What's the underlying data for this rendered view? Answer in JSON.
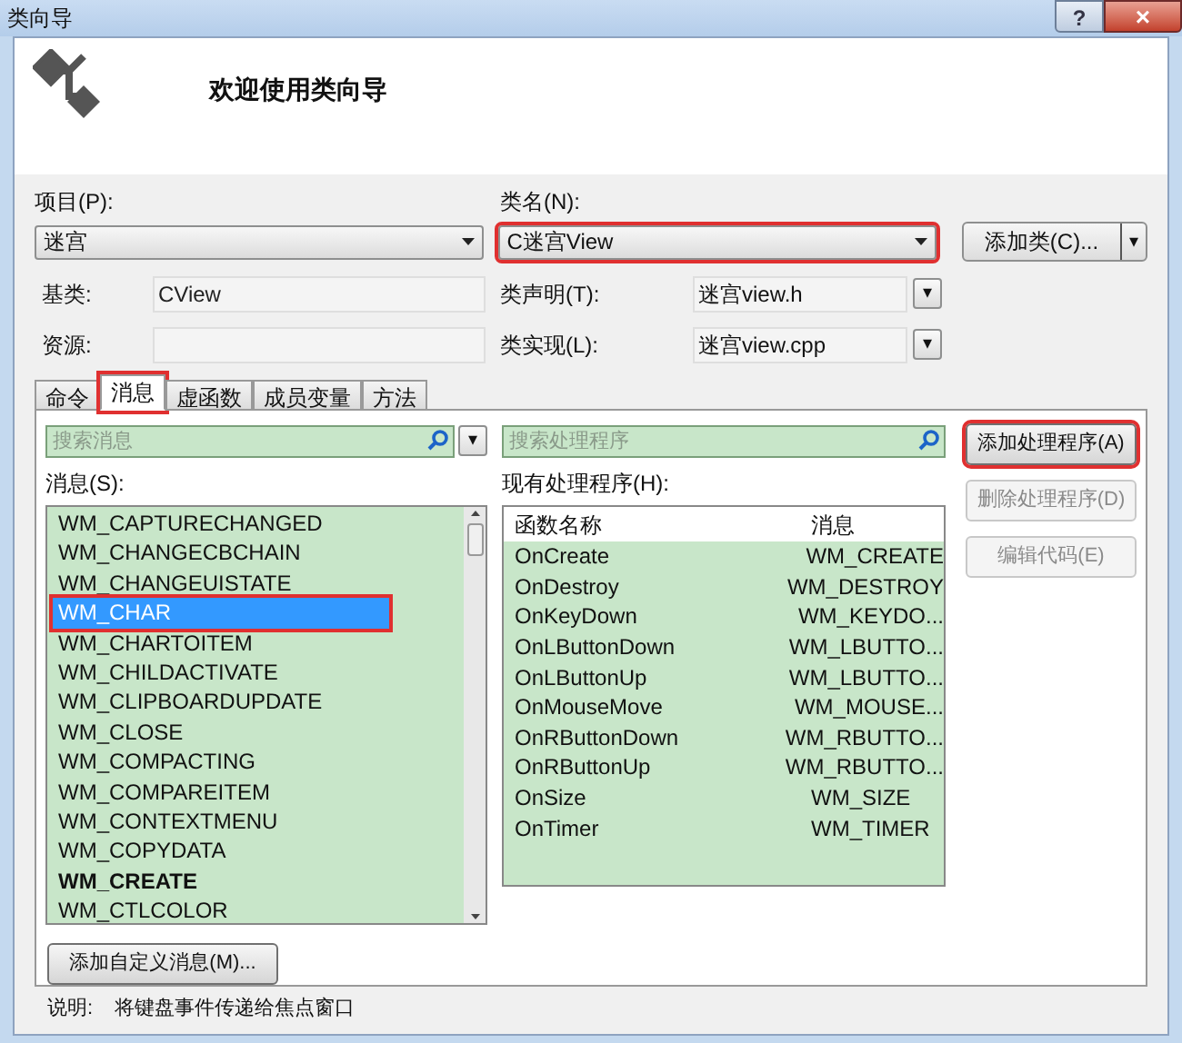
{
  "window": {
    "title": "类向导",
    "help_button": "?",
    "close_button": "×"
  },
  "header": {
    "title": "欢迎使用类向导"
  },
  "project": {
    "label": "项目(P):",
    "value": "迷宫",
    "highlighted": false
  },
  "class_name": {
    "label": "类名(N):",
    "value": "C迷宫View",
    "highlighted": true
  },
  "add_class_button": {
    "label": "添加类(C)...",
    "dropdown": "▾"
  },
  "base_class": {
    "label": "基类:",
    "value": "CView"
  },
  "resource": {
    "label": "资源:"
  },
  "class_declaration": {
    "label": "类声明(T):",
    "value": "迷宫view.h",
    "dropdown": "▾"
  },
  "class_implementation": {
    "label": "类实现(L):",
    "value": "迷宫view.cpp",
    "dropdown": "▾"
  },
  "tabs": [
    {
      "label": "命令",
      "selected": false,
      "highlighted": false
    },
    {
      "label": "消息",
      "selected": true,
      "highlighted": true
    },
    {
      "label": "虚函数",
      "selected": false,
      "highlighted": false
    },
    {
      "label": "成员变量",
      "selected": false,
      "highlighted": false
    },
    {
      "label": "方法",
      "selected": false,
      "highlighted": false
    }
  ],
  "message_search": {
    "placeholder": "搜索消息",
    "dropdown": "▾"
  },
  "messages_label": "消息(S):",
  "messages": [
    {
      "name": "WM_CAPTURECHANGED",
      "selected": false,
      "has_handler": false
    },
    {
      "name": "WM_CHANGECBCHAIN",
      "selected": false,
      "has_handler": false
    },
    {
      "name": "WM_CHANGEUISTATE",
      "selected": false,
      "has_handler": false
    },
    {
      "name": "WM_CHAR",
      "selected": true,
      "has_handler": false
    },
    {
      "name": "WM_CHARTOITEM",
      "selected": false,
      "has_handler": false
    },
    {
      "name": "WM_CHILDACTIVATE",
      "selected": false,
      "has_handler": false
    },
    {
      "name": "WM_CLIPBOARDUPDATE",
      "selected": false,
      "has_handler": false
    },
    {
      "name": "WM_CLOSE",
      "selected": false,
      "has_handler": false
    },
    {
      "name": "WM_COMPACTING",
      "selected": false,
      "has_handler": false
    },
    {
      "name": "WM_COMPAREITEM",
      "selected": false,
      "has_handler": false
    },
    {
      "name": "WM_CONTEXTMENU",
      "selected": false,
      "has_handler": false
    },
    {
      "name": "WM_COPYDATA",
      "selected": false,
      "has_handler": false
    },
    {
      "name": "WM_CREATE",
      "selected": false,
      "has_handler": true
    },
    {
      "name": "WM_CTLCOLOR",
      "selected": false,
      "has_handler": false
    }
  ],
  "handler_search": {
    "placeholder": "搜索处理程序"
  },
  "handlers_label": "现有处理程序(H):",
  "handler_columns": [
    "函数名称",
    "消息"
  ],
  "handlers": [
    {
      "function": "OnCreate",
      "message": "WM_CREATE"
    },
    {
      "function": "OnDestroy",
      "message": "WM_DESTROY"
    },
    {
      "function": "OnKeyDown",
      "message": "WM_KEYDO..."
    },
    {
      "function": "OnLButtonDown",
      "message": "WM_LBUTTO..."
    },
    {
      "function": "OnLButtonUp",
      "message": "WM_LBUTTO..."
    },
    {
      "function": "OnMouseMove",
      "message": "WM_MOUSE..."
    },
    {
      "function": "OnRButtonDown",
      "message": "WM_RBUTTO..."
    },
    {
      "function": "OnRButtonUp",
      "message": "WM_RBUTTO..."
    },
    {
      "function": "OnSize",
      "message": "WM_SIZE"
    },
    {
      "function": "OnTimer",
      "message": "WM_TIMER"
    }
  ],
  "action_buttons": [
    {
      "label": "添加处理程序(A)",
      "disabled": false,
      "highlighted": true
    },
    {
      "label": "删除处理程序(D)",
      "disabled": true,
      "highlighted": false
    },
    {
      "label": "编辑代码(E)",
      "disabled": true,
      "highlighted": false
    }
  ],
  "add_custom_message_button": "添加自定义消息(M)...",
  "description": {
    "label": "说明:",
    "text": "将键盘事件传递给焦点窗口"
  }
}
